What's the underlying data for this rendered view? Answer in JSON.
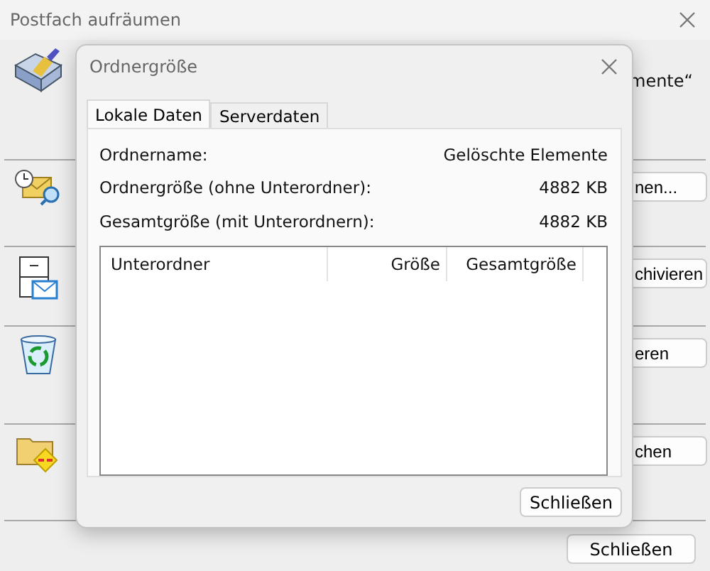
{
  "background_window": {
    "title": "Postfach aufräumen",
    "sections": [
      {
        "kind": "text",
        "text": "mente“"
      },
      {
        "kind": "button",
        "text": "nen..."
      },
      {
        "kind": "button",
        "text": "chivieren"
      },
      {
        "kind": "button",
        "text": "eren"
      },
      {
        "kind": "button",
        "text": "chen"
      }
    ],
    "buttons": [
      "Schließen"
    ]
  },
  "dialog": {
    "title": "Ordnergröße",
    "tabs": [
      {
        "label": "Lokale Daten",
        "selected": true
      },
      {
        "label": "Serverdaten",
        "selected": false
      }
    ],
    "fields": [
      {
        "label": "Ordnername:",
        "value": "Gelöschte Elemente"
      },
      {
        "label": "Ordnergröße (ohne Unterordner):",
        "value": "4882 KB"
      },
      {
        "label": "Gesamtgröße (mit Unterordnern):",
        "value": "4882 KB"
      }
    ],
    "table": {
      "columns": [
        "Unterordner",
        "Größe",
        "Gesamtgröße"
      ]
    },
    "buttons": [
      "Schließen"
    ]
  }
}
